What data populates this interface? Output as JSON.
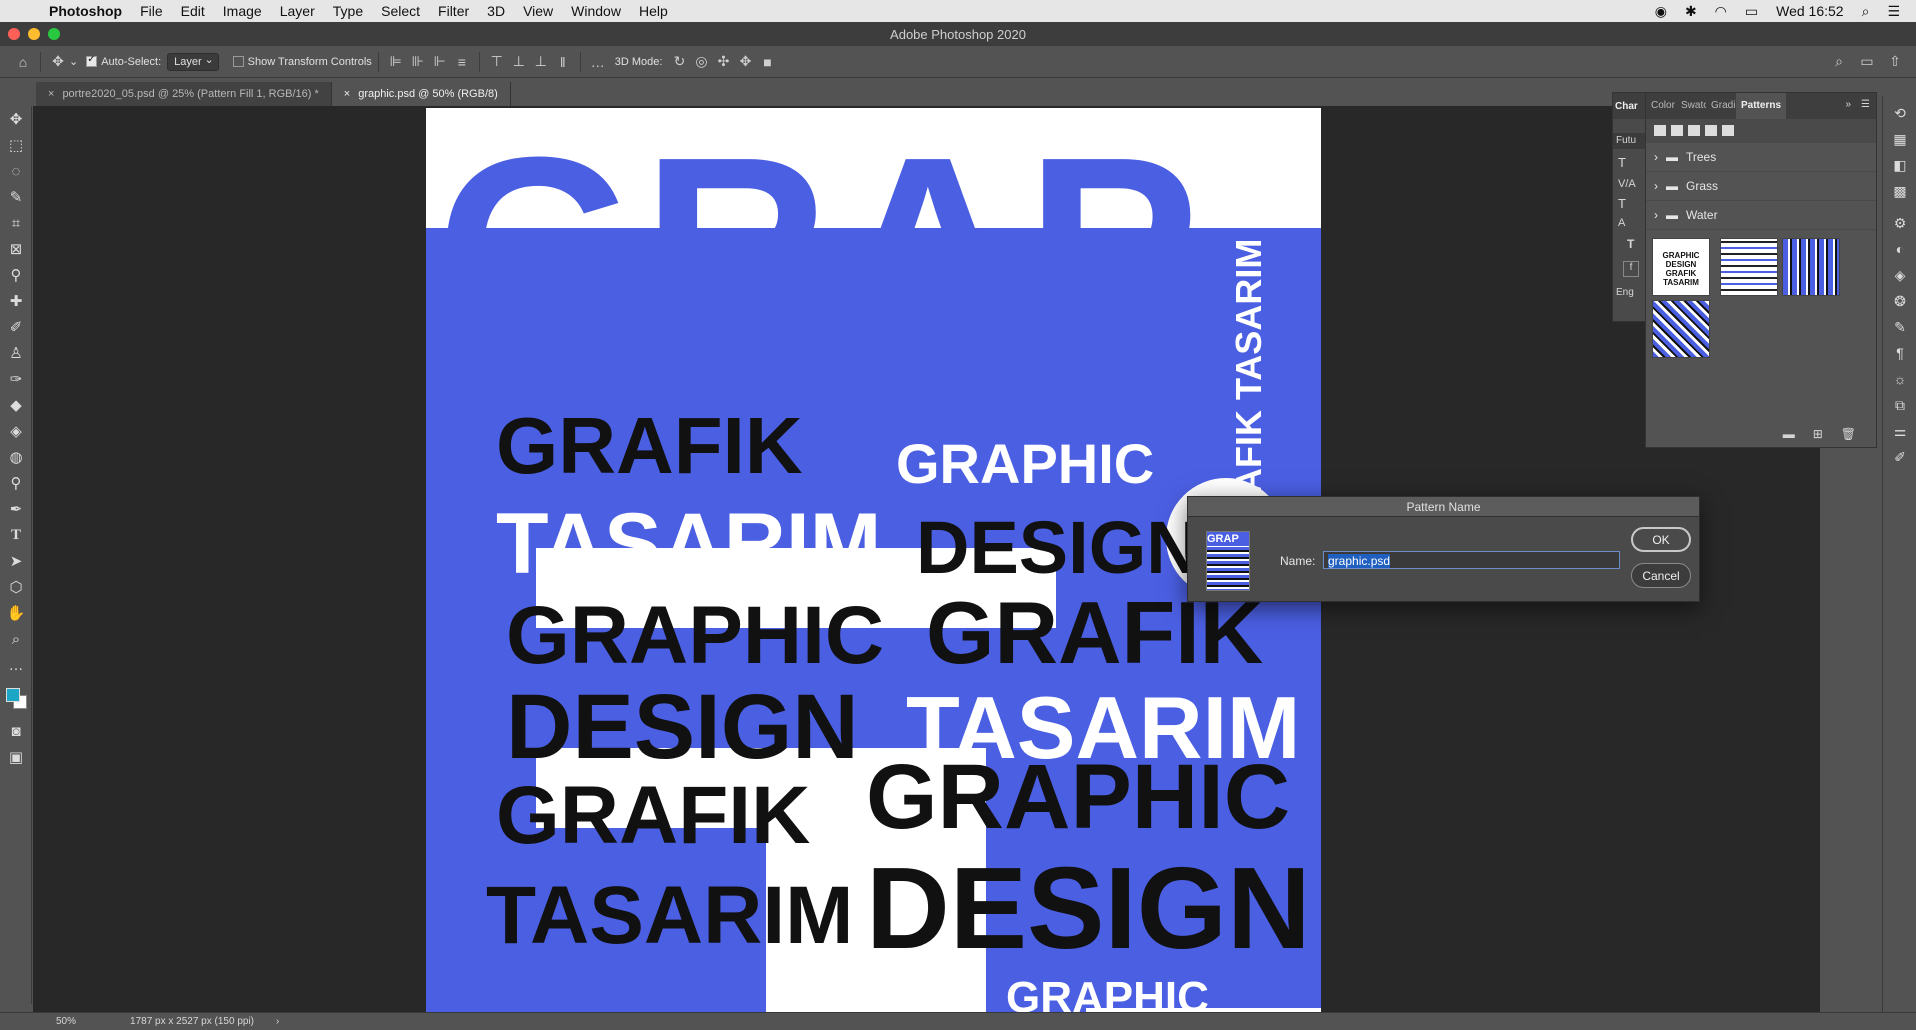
{
  "menubar": {
    "app_name": "Photoshop",
    "items": [
      "File",
      "Edit",
      "Image",
      "Layer",
      "Type",
      "Select",
      "Filter",
      "3D",
      "View",
      "Window",
      "Help"
    ],
    "clock": "Wed 16:52"
  },
  "window": {
    "title": "Adobe Photoshop 2020"
  },
  "options": {
    "auto_select_label": "Auto-Select:",
    "auto_select_value": "Layer",
    "transform_label": "Show Transform Controls",
    "mode_3d_label": "3D Mode:"
  },
  "tabs": [
    {
      "label": "portre2020_05.psd @ 25% (Pattern Fill 1, RGB/16) *"
    },
    {
      "label": "graphic.psd @ 50% (RGB/8)"
    }
  ],
  "status": {
    "zoom": "50%",
    "doc_info": "1787 px x 2527 px (150 ppi)"
  },
  "panels": {
    "char_tabs": [
      "Char",
      "Color",
      "Swatc",
      "Gradi",
      "Patterns"
    ],
    "char_fields": [
      "Futu",
      "Eng"
    ],
    "pattern_groups": [
      "Trees",
      "Grass",
      "Water"
    ]
  },
  "poster": {
    "title_big": "GRAP",
    "words": [
      "GRAFIK",
      "GRAPHIC",
      "TASARIM",
      "DESIGN",
      "GRAFIK TASARIM"
    ],
    "thumb_text": [
      "GRAPHIC",
      "DESIGN",
      "GRAFIK",
      "TASARIM"
    ]
  },
  "dialog": {
    "title": "Pattern Name",
    "name_label": "Name:",
    "name_value": "graphic.psd",
    "ok_label": "OK",
    "cancel_label": "Cancel"
  },
  "colors": {
    "accent_blue": "#4b5fe3",
    "foreground": "#1aa6c4",
    "selection": "#1f5fbf"
  },
  "icons": [
    "apple-icon",
    "creative-cloud-icon",
    "wifi-icon",
    "search-icon",
    "list-icon",
    "home-icon",
    "move-icon",
    "folder-icon",
    "new-pattern-icon",
    "trash-icon"
  ]
}
